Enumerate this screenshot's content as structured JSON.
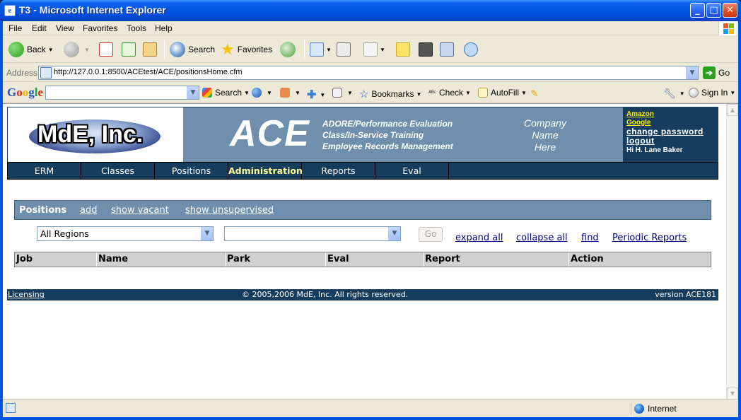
{
  "window": {
    "title": "T3 - Microsoft Internet Explorer"
  },
  "menubar": [
    "File",
    "Edit",
    "View",
    "Favorites",
    "Tools",
    "Help"
  ],
  "toolbar": {
    "back": "Back",
    "search": "Search",
    "favorites": "Favorites"
  },
  "address": {
    "label": "Address",
    "url": "http://127.0.0.1:8500/ACEtest/ACE/positionsHome.cfm",
    "go": "Go"
  },
  "googlebar": {
    "logo": "Google",
    "search": "Search",
    "bookmarks": "Bookmarks",
    "check": "Check",
    "autofill": "AutoFill",
    "signin": "Sign In"
  },
  "banner": {
    "logo_text": "MdE, Inc.",
    "app_title": "ACE",
    "subtitles": [
      "ADORE/Performance Evaluation",
      "Class/In-Service Training",
      "Employee Records Management"
    ],
    "company": [
      "Company",
      "Name",
      "Here"
    ],
    "links": {
      "amazon": "Amazon",
      "google": "Google",
      "change_password": "change password",
      "logout": "logout"
    },
    "greeting": "Hi H. Lane Baker"
  },
  "nav": {
    "items": [
      "ERM",
      "Classes",
      "Positions",
      "Administration",
      "Reports",
      "Eval"
    ],
    "active": "Administration"
  },
  "positions": {
    "title": "Positions",
    "add": "add",
    "show_vacant": "show vacant",
    "show_unsupervised": "show unsupervised"
  },
  "filters": {
    "region_selected": "All Regions",
    "second_selected": "",
    "go": "Go",
    "expand_all": "expand all",
    "collapse_all": "collapse all",
    "find": "find",
    "periodic_reports": "Periodic Reports"
  },
  "table": {
    "columns": [
      "Job",
      "Name",
      "Park",
      "Eval",
      "Report",
      "Action"
    ]
  },
  "footer": {
    "licensing": "Licensing",
    "copyright": "© 2005,2006 MdE, Inc. All rights reserved.",
    "version": "version ACE181"
  },
  "statusbar": {
    "zone": "Internet"
  },
  "colors": {
    "banner_blue": "#6f8fad",
    "navy": "#163d5e",
    "active_nav": "#ffff99",
    "link_yellow": "#ffee00"
  }
}
